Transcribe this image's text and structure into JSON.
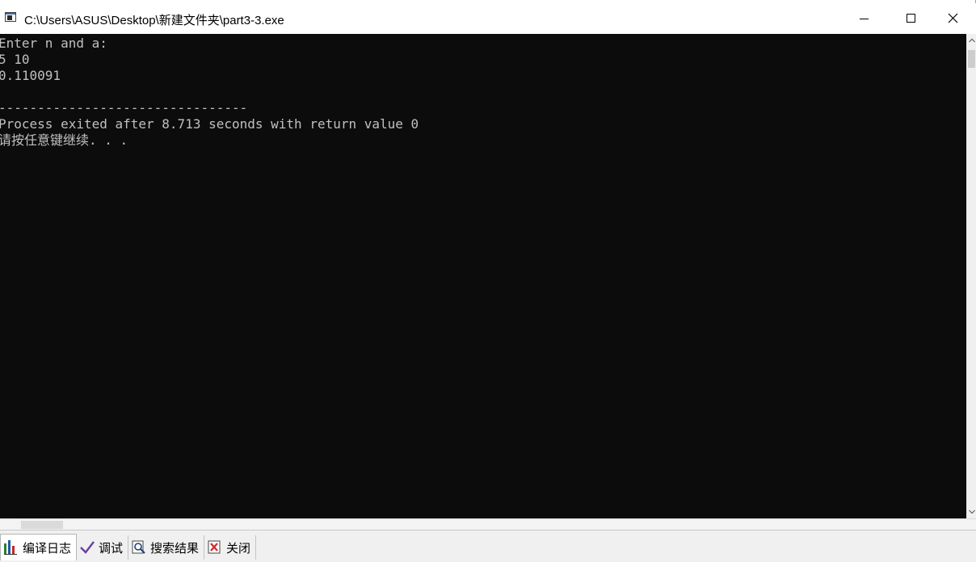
{
  "window": {
    "title": "C:\\Users\\ASUS\\Desktop\\新建文件夹\\part3-3.exe",
    "icon": "console-app-icon",
    "controls": {
      "minimize": "minimize-icon",
      "maximize": "maximize-icon",
      "close": "close-icon"
    }
  },
  "console": {
    "background": "#0c0c0c",
    "foreground": "#c0c0c0",
    "lines": [
      "Enter n and a:",
      "5 10",
      "0.110091",
      "",
      "--------------------------------",
      "Process exited after 8.713 seconds with return value 0",
      "请按任意键继续. . ."
    ]
  },
  "ide_tabs": [
    {
      "label": "编译日志",
      "icon": "bar-chart-icon"
    },
    {
      "label": "调试",
      "icon": "check-icon"
    },
    {
      "label": "搜索结果",
      "icon": "search-document-icon"
    },
    {
      "label": "关闭",
      "icon": "close-red-icon"
    }
  ]
}
